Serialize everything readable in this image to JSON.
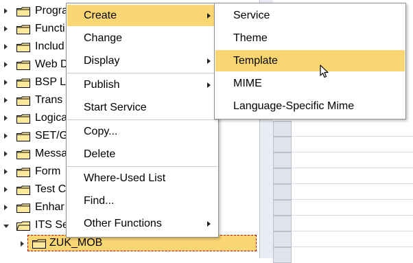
{
  "tree": {
    "items": [
      {
        "label": "Progra",
        "expanded": false
      },
      {
        "label": "Functi",
        "expanded": false
      },
      {
        "label": "Includ",
        "expanded": false
      },
      {
        "label": "Web D",
        "expanded": false
      },
      {
        "label": "BSP L",
        "expanded": false
      },
      {
        "label": "Trans",
        "expanded": false
      },
      {
        "label": "Logica",
        "expanded": false
      },
      {
        "label": "SET/G",
        "expanded": false
      },
      {
        "label": "Messa",
        "expanded": false
      },
      {
        "label": "Form",
        "expanded": false
      },
      {
        "label": "Test C",
        "expanded": false
      },
      {
        "label": "Enhar",
        "expanded": false
      },
      {
        "label": "ITS Se",
        "expanded": true
      }
    ],
    "selected_child": {
      "label": "ZUK_MOB"
    }
  },
  "context_menu": {
    "items": [
      {
        "label": "Create",
        "submenu": true,
        "highlighted": true
      },
      {
        "label": "Change",
        "submenu": false
      },
      {
        "label": "Display",
        "submenu": true
      },
      {
        "label": "Publish",
        "submenu": true
      },
      {
        "label": "Start Service",
        "submenu": false
      },
      {
        "label": "Copy...",
        "submenu": false
      },
      {
        "label": "Delete",
        "submenu": false
      },
      {
        "label": "Where-Used List",
        "submenu": false
      },
      {
        "label": "Find...",
        "submenu": false
      },
      {
        "label": "Other Functions",
        "submenu": true
      }
    ]
  },
  "create_submenu": {
    "items": [
      {
        "label": "Service"
      },
      {
        "label": "Theme"
      },
      {
        "label": "Template",
        "highlighted": true
      },
      {
        "label": "MIME"
      },
      {
        "label": "Language-Specific Mime"
      }
    ]
  },
  "colors": {
    "highlight": "#fbd774",
    "folder_fill": "#fde99a",
    "selection_border": "#c00000"
  }
}
